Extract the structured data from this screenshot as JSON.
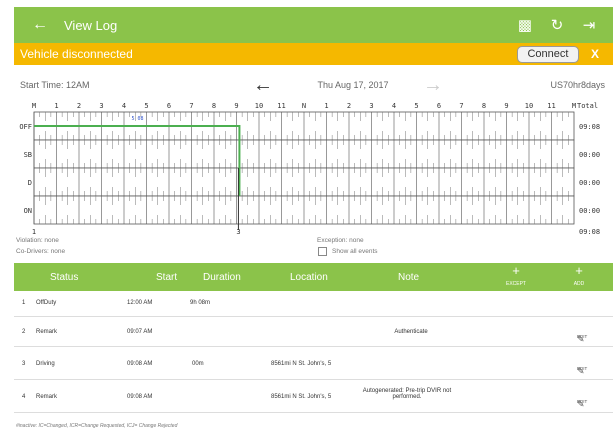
{
  "header": {
    "title": "View Log",
    "back_icon": "arrow-back-icon",
    "icons": [
      "inspector-icon",
      "refresh-icon",
      "logout-icon"
    ],
    "color": "#8bc34a"
  },
  "banner": {
    "message": "Vehicle disconnected",
    "connect_label": "Connect",
    "close_label": "X",
    "color": "#f5b800"
  },
  "nav": {
    "start_time": "Start Time: 12AM",
    "date": "Thu Aug 17, 2017",
    "ruleset": "US70hr8days"
  },
  "graph": {
    "hour_labels": [
      "M",
      "1",
      "2",
      "3",
      "4",
      "5",
      "6",
      "7",
      "8",
      "9",
      "10",
      "11",
      "N",
      "1",
      "2",
      "3",
      "4",
      "5",
      "6",
      "7",
      "8",
      "9",
      "10",
      "11",
      "M"
    ],
    "total_label": "Total",
    "rows": [
      {
        "label": "OFF",
        "total": "09:08"
      },
      {
        "label": "SB",
        "total": "00:00"
      },
      {
        "label": "D",
        "total": "00:00"
      },
      {
        "label": "ON",
        "total": "00:00"
      }
    ],
    "grand_total": "09:08",
    "event_marker": "5 08",
    "bottom_left": "1",
    "bottom_mid": "3",
    "line_color": "#4caf50",
    "duty_hours": {
      "off_start": 0,
      "off_end": 9.13
    }
  },
  "info": {
    "violation": "Violation: none",
    "codrivers": "Co-Drivers: none",
    "exception": "Exception: none",
    "show_all": "Show all events"
  },
  "table": {
    "headers": {
      "status": "Status",
      "start": "Start",
      "duration": "Duration",
      "location": "Location",
      "note": "Note",
      "except": "EXCEPT",
      "add": "ADD",
      "plus": "+"
    },
    "rows": [
      {
        "num": "1",
        "status": "OffDuty",
        "start": "12:00 AM",
        "duration": "9h 08m",
        "location": "",
        "note": "",
        "edit": ""
      },
      {
        "num": "2",
        "status": "Remark",
        "start": "09:07 AM",
        "duration": "",
        "location": "",
        "note": "Authenticate",
        "edit": "EDIT"
      },
      {
        "num": "3",
        "status": "Driving",
        "start": "09:08 AM",
        "duration": "00m",
        "location": "8561mi N St. John's, 5",
        "note": "",
        "edit": "EDIT"
      },
      {
        "num": "4",
        "status": "Remark",
        "start": "09:08 AM",
        "duration": "",
        "location": "8561mi N St. John's, 5",
        "note": "Autogenerated: Pre-trip DVIR not performed.",
        "edit": "EDIT"
      }
    ],
    "legend": "#inactive: IC=Changed, ICR=Change Requested, ICJ= Change Rejected"
  }
}
